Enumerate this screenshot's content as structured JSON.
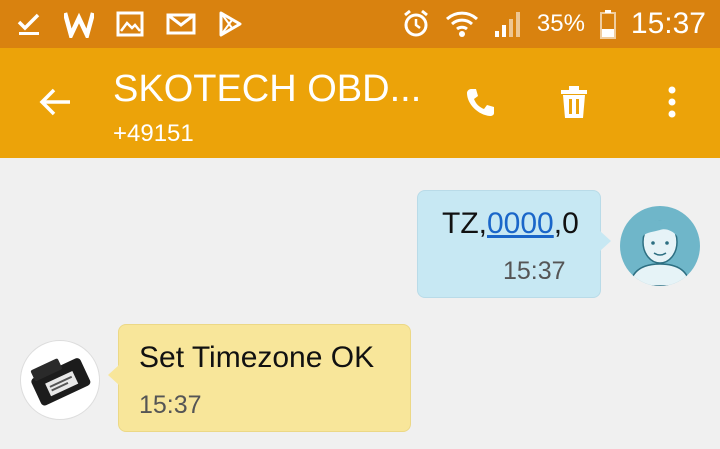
{
  "status_bar": {
    "battery_percent": "35%",
    "time": "15:37",
    "battery_level": 0.35,
    "left_icons": [
      "download-done-icon",
      "w-app-icon",
      "gallery-icon",
      "mail-icon",
      "play-store-icon"
    ],
    "right_icons": [
      "alarm-icon",
      "wifi-icon",
      "signal-icon",
      "battery-icon"
    ]
  },
  "app_bar": {
    "title": "SKOTECH OBD...",
    "subtitle": "+49151",
    "icons": [
      "back-arrow-icon",
      "phone-icon",
      "trash-icon",
      "more-vert-icon"
    ]
  },
  "messages": [
    {
      "direction": "outgoing",
      "text_prefix": "TZ,",
      "text_link": "0000",
      "text_suffix": ",0",
      "time": "15:37",
      "bubble_color": "#c7e8f3"
    },
    {
      "direction": "incoming",
      "text": "Set Timezone OK",
      "time": "15:37",
      "bubble_color": "#f8e69a"
    }
  ],
  "colors": {
    "status_bar": "#d9820f",
    "app_bar": "#eca309",
    "background": "#f0f0f0",
    "link": "#1a66c9"
  }
}
